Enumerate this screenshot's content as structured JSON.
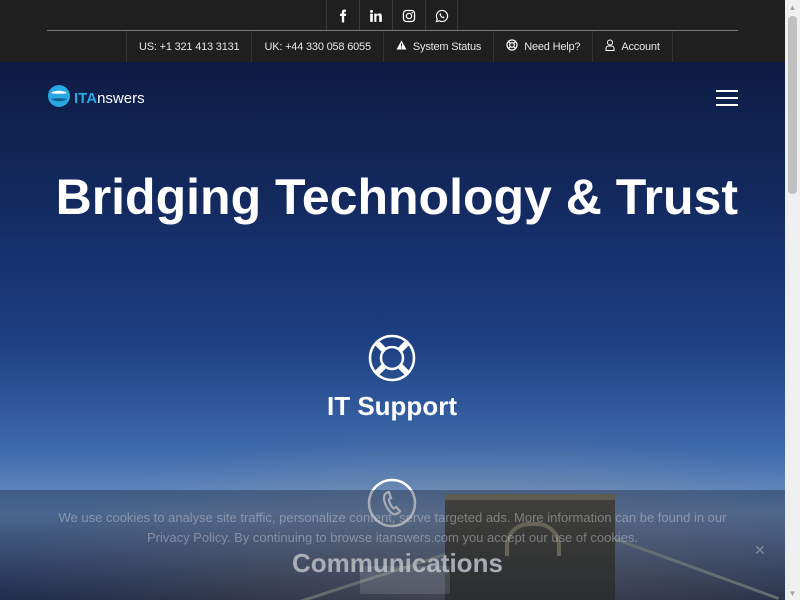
{
  "topbar": {
    "social": [
      "facebook-icon",
      "linkedin-icon",
      "instagram-icon",
      "whatsapp-icon"
    ],
    "contact_us": "US: +1 321 413 3131",
    "contact_uk": "UK: +44 330 058 6055",
    "system_status": "System Status",
    "need_help": "Need Help?",
    "account": "Account"
  },
  "logo": {
    "part1": "ITA",
    "part2": "nswers"
  },
  "hero": {
    "headline": "Bridging Technology & Trust"
  },
  "services": [
    {
      "label": "IT Support",
      "icon": "lifebuoy-icon"
    },
    {
      "label": "Communications",
      "icon": "phone-icon"
    }
  ],
  "cookie": {
    "text": "We use cookies to analyse site traffic, personalize content, serve targeted ads. More information can be found in our Privacy Policy. By continuing to browse itanswers.com you accept our use of cookies."
  },
  "colors": {
    "topbar": "#1f1f1f",
    "brand_blue": "#2aa8e0",
    "hero_top": "#0d1c44"
  }
}
